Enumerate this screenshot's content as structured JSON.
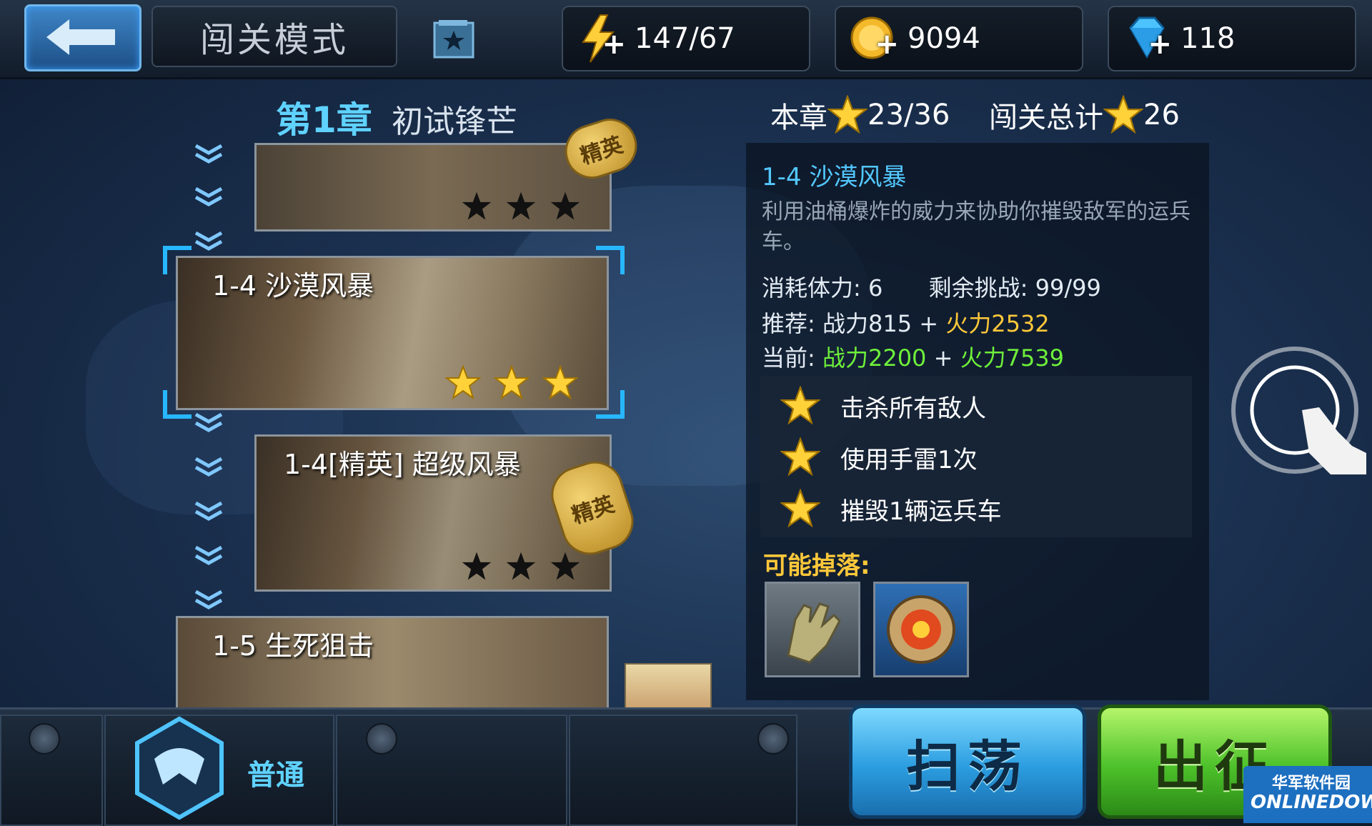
{
  "topbar": {
    "mode_title": "闯关模式",
    "energy": "147/67",
    "gold": "9094",
    "diamonds": "118"
  },
  "chapter": {
    "number": "第1章",
    "name": "初试锋芒",
    "chapter_stars_label": "本章",
    "chapter_stars": "23/36",
    "total_stars_label": "闯关总计",
    "total_stars": "26"
  },
  "levels": [
    {
      "title": "",
      "elite_tag": "精英",
      "stars_earned": 0
    },
    {
      "title": "1-4 沙漠风暴",
      "stars_earned": 3,
      "selected": true
    },
    {
      "title": "1-4[精英] 超级风暴",
      "elite_tag": "精英",
      "stars_earned": 0
    },
    {
      "title": "1-5 生死狙击"
    }
  ],
  "detail": {
    "title": "1-4 沙漠风暴",
    "description": "利用油桶爆炸的威力来协助你摧毁敌军的运兵车。",
    "stamina_label": "消耗体力:",
    "stamina_value": "6",
    "remaining_label": "剩余挑战:",
    "remaining_value": "99/99",
    "recommend_label": "推荐:",
    "recommend_power": "战力815",
    "recommend_plus": "+",
    "recommend_fire": "火力2532",
    "current_label": "当前:",
    "current_power": "战力2200",
    "current_plus": "+",
    "current_fire": "火力7539",
    "conditions": [
      "击杀所有敌人",
      "使用手雷1次",
      "摧毁1辆运兵车"
    ],
    "drops_label": "可能掉落:",
    "drops": [
      {
        "icon": "glove-icon"
      },
      {
        "icon": "target-chip-icon"
      }
    ]
  },
  "bottom": {
    "difficulty_label": "普通",
    "sweep_button": "扫荡",
    "go_button": "出征"
  },
  "watermark": {
    "cn": "华军软件园",
    "en": "ONLINEDOWN"
  },
  "colors": {
    "accent_blue": "#53c8ff",
    "yellow": "#ffc83a",
    "green": "#6ef03a",
    "star_gold": "#ffd23a"
  }
}
